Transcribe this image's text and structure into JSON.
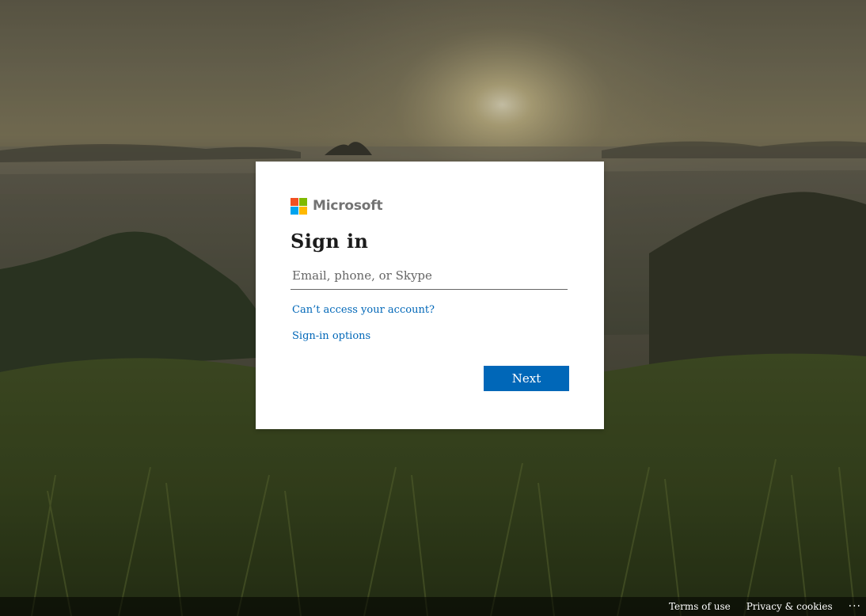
{
  "brand": {
    "name": "Microsoft",
    "logo_colors": [
      "#f25022",
      "#7fba00",
      "#00a4ef",
      "#ffb900"
    ]
  },
  "card": {
    "title": "Sign in",
    "input": {
      "value": "",
      "placeholder": "Email, phone, or Skype"
    },
    "links": {
      "cant_access": "Can’t access your account?",
      "signin_options": "Sign-in options"
    },
    "next_label": "Next"
  },
  "footer": {
    "terms": "Terms of use",
    "privacy": "Privacy & cookies",
    "more": "···"
  },
  "colors": {
    "accent": "#0067b8",
    "link": "#0067b8",
    "title": "#1b1b1b"
  }
}
